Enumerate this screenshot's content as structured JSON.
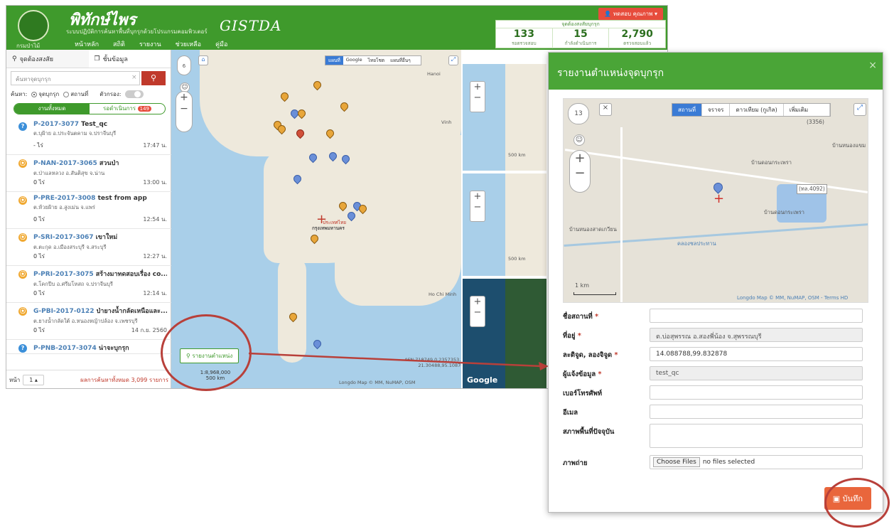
{
  "header": {
    "logo_caption": "กรมป่าไม้",
    "brand": "พิทักษ์ไพร",
    "tagline": "ระบบปฏิบัติการค้นหาพื้นที่บุกรุกด้วยโปรแกรมคอมพิวเตอร์",
    "partner": "GISTDA",
    "nav": [
      "หน้าหลัก",
      "สถิติ",
      "รายงาน",
      "ช่วยเหลือ",
      "คู่มือ"
    ],
    "user": "ทดสอบ คุณภาพ",
    "stats_title": "จุดต้องสงสัยบุกรุก",
    "stats": [
      {
        "value": "133",
        "label": "รอตรวจสอบ"
      },
      {
        "value": "15",
        "label": "กำลังดำเนินการ"
      },
      {
        "value": "2,790",
        "label": "ตรวจสอบแล้ว"
      }
    ]
  },
  "sidebar": {
    "tab1": "จุดต้องสงสัย",
    "tab2": "ชั้นข้อมูล",
    "search_placeholder": "ค้นหาจุดบุกรุก",
    "filter_label": "ค้นหา:",
    "radio1": "จุดบุกรุก",
    "radio2": "สถานที่",
    "toggle_label": "ตัวกรอง:",
    "seg_all": "งานทั้งหมด",
    "seg_pending": "รอดำเนินการ",
    "seg_badge": "149",
    "items": [
      {
        "code": "P-2017-3077",
        "title": "Test_qc",
        "addr": "ต.บุฝ้าย อ.ประจันตคาม จ.ปราจีนบุรี",
        "area": "- ไร่",
        "time": "17:47 น.",
        "color": "blue"
      },
      {
        "code": "P-NAN-2017-3065",
        "title": "สวนป่า",
        "addr": "ต.ป่าแลหลวง อ.สันติสุข จ.น่าน",
        "area": "0 ไร่",
        "time": "13:00 น.",
        "color": "orange"
      },
      {
        "code": "P-PRE-2017-3008",
        "title": "test from app",
        "addr": "ต.ห้วยฝ้าย อ.สูงเม่น จ.แพร่",
        "area": "0 ไร่",
        "time": "12:54 น.",
        "color": "orange"
      },
      {
        "code": "P-SRI-2017-3067",
        "title": "เขาใหม่",
        "addr": "ต.ตะกุด อ.เมืองสระบุรี จ.สระบุรี",
        "area": "0 ไร่",
        "time": "12:27 น.",
        "color": "orange"
      },
      {
        "code": "P-PRI-2017-3075",
        "title": "สร้างมาทดสอบเรื่อง co...",
        "addr": "ต.โคกปีบ อ.ศรีมโหสถ จ.ปราจีนบุรี",
        "area": "0 ไร่",
        "time": "12:14 น.",
        "color": "orange"
      },
      {
        "code": "G-PBI-2017-0122",
        "title": "ป่ายางน้ำกลัดเหนือและ...",
        "addr": "ต.ยางน้ำกลัดใต้ อ.หนองหญ้าปล้อง จ.เพชรบุรี",
        "area": "0 ไร่",
        "time": "14 ก.ย. 2560",
        "color": "orange"
      },
      {
        "code": "P-PNB-2017-3074",
        "title": "น่าจะบุกรุก",
        "addr": "",
        "area": "",
        "time": "",
        "color": "blue"
      }
    ],
    "page_label": "หน้า",
    "page_value": "1",
    "total": "ผลการค้นหาทั้งหมด 3,099 รายการ"
  },
  "map": {
    "zoom": "6",
    "layer_tabs": [
      "แผนที่",
      "Google",
      "ไทยโชต",
      "แผนที่อื่นๆ"
    ],
    "report_button": "รายงานตำแหน่ง",
    "scale_ratio": "1:8,968,000",
    "scale_km": "500 km",
    "coords": "46N,718749.0,2357353.3",
    "coords2": "21.30488,95.10876",
    "attribution": "Longdo Map © MM, NuMAP, OSM",
    "labels": [
      "ประเทศไทย",
      "กรุงเทพมหานคร",
      "Hanoi",
      "Vinh",
      "Bangkok",
      "Ho Chi Minh"
    ],
    "sub_scale": "500 km",
    "google": "Google"
  },
  "modal": {
    "title": "รายงานตำแหน่งจุดบุกรุก",
    "zoom": "13",
    "map_tabs": [
      "สถานที่",
      "จราจร",
      "ดาวเทียม (กูเกิล)",
      "เพิ่มเติม"
    ],
    "map_labels": [
      "บ้านหนองแขม",
      "บ้านดอนกระเพรา",
      "บ้านดอนกระเพรา",
      "บ้านหนองสาดเกวียน",
      "(3356)",
      "(ทล.4092)",
      "คลองชลประทาน"
    ],
    "scale": "1 km",
    "attribution": "Longdo Map © MM, NuMAP, OSM - Terms HD",
    "fields": [
      {
        "label": "ชื่อสถานที่",
        "required": "*",
        "value": "",
        "ro": false
      },
      {
        "label": "ที่อยู่",
        "required": "*",
        "value": "ต.บ่อสุพรรณ อ.สองพี่น้อง จ.สุพรรณบุรี",
        "ro": true
      },
      {
        "label": "ละติจูด, ลองจิจูด",
        "required": "*",
        "value": "14.088788,99.832878",
        "ro": false
      },
      {
        "label": "ผู้แจ้งข้อมูล",
        "required": "*",
        "value": "test_qc",
        "ro": true
      },
      {
        "label": "เบอร์โทรศัพท์",
        "required": "",
        "value": "",
        "ro": false
      },
      {
        "label": "อีเมล",
        "required": "",
        "value": "",
        "ro": false
      },
      {
        "label": "สภาพพื้นที่ปัจจุบัน",
        "required": "",
        "value": "",
        "ro": false
      },
      {
        "label": "ภาพถ่าย",
        "required": "",
        "value": "",
        "ro": false
      }
    ],
    "file_button": "Choose Files",
    "file_status": "no files selected",
    "save": "บันทึก"
  },
  "colors": {
    "header": "#3f9a2c",
    "save": "#e9663c",
    "annotation": "#b8403a"
  }
}
